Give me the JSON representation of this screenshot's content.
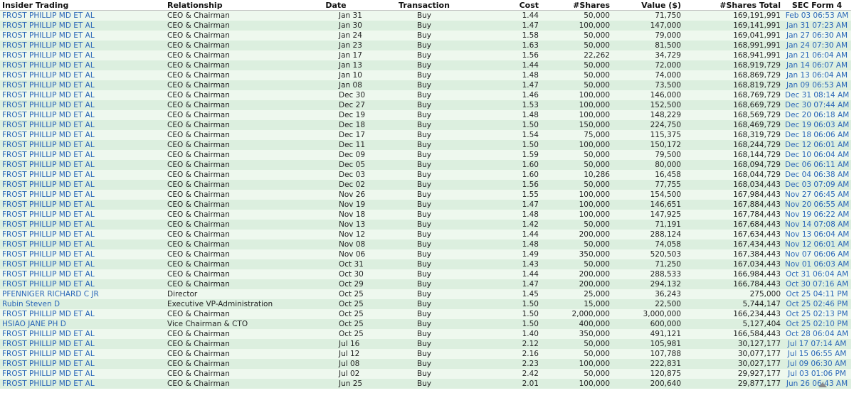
{
  "table": {
    "headers": [
      "Insider Trading",
      "Relationship",
      "Date",
      "Transaction",
      "Cost",
      "#Shares",
      "Value ($)",
      "#Shares Total",
      "SEC Form 4"
    ],
    "rows": [
      [
        "FROST PHILLIP MD ET AL",
        "CEO & Chairman",
        "Jan 31",
        "Buy",
        "1.44",
        "50,000",
        "71,750",
        "169,191,991",
        "Feb 03 06:53 AM"
      ],
      [
        "FROST PHILLIP MD ET AL",
        "CEO & Chairman",
        "Jan 30",
        "Buy",
        "1.47",
        "100,000",
        "147,000",
        "169,141,991",
        "Jan 31 07:23 AM"
      ],
      [
        "FROST PHILLIP MD ET AL",
        "CEO & Chairman",
        "Jan 24",
        "Buy",
        "1.58",
        "50,000",
        "79,000",
        "169,041,991",
        "Jan 27 06:30 AM"
      ],
      [
        "FROST PHILLIP MD ET AL",
        "CEO & Chairman",
        "Jan 23",
        "Buy",
        "1.63",
        "50,000",
        "81,500",
        "168,991,991",
        "Jan 24 07:30 AM"
      ],
      [
        "FROST PHILLIP MD ET AL",
        "CEO & Chairman",
        "Jan 17",
        "Buy",
        "1.56",
        "22,262",
        "34,729",
        "168,941,991",
        "Jan 21 06:04 AM"
      ],
      [
        "FROST PHILLIP MD ET AL",
        "CEO & Chairman",
        "Jan 13",
        "Buy",
        "1.44",
        "50,000",
        "72,000",
        "168,919,729",
        "Jan 14 06:07 AM"
      ],
      [
        "FROST PHILLIP MD ET AL",
        "CEO & Chairman",
        "Jan 10",
        "Buy",
        "1.48",
        "50,000",
        "74,000",
        "168,869,729",
        "Jan 13 06:04 AM"
      ],
      [
        "FROST PHILLIP MD ET AL",
        "CEO & Chairman",
        "Jan 08",
        "Buy",
        "1.47",
        "50,000",
        "73,500",
        "168,819,729",
        "Jan 09 06:53 AM"
      ],
      [
        "FROST PHILLIP MD ET AL",
        "CEO & Chairman",
        "Dec 30",
        "Buy",
        "1.46",
        "100,000",
        "146,000",
        "168,769,729",
        "Dec 31 08:14 AM"
      ],
      [
        "FROST PHILLIP MD ET AL",
        "CEO & Chairman",
        "Dec 27",
        "Buy",
        "1.53",
        "100,000",
        "152,500",
        "168,669,729",
        "Dec 30 07:44 AM"
      ],
      [
        "FROST PHILLIP MD ET AL",
        "CEO & Chairman",
        "Dec 19",
        "Buy",
        "1.48",
        "100,000",
        "148,229",
        "168,569,729",
        "Dec 20 06:18 AM"
      ],
      [
        "FROST PHILLIP MD ET AL",
        "CEO & Chairman",
        "Dec 18",
        "Buy",
        "1.50",
        "150,000",
        "224,750",
        "168,469,729",
        "Dec 19 06:03 AM"
      ],
      [
        "FROST PHILLIP MD ET AL",
        "CEO & Chairman",
        "Dec 17",
        "Buy",
        "1.54",
        "75,000",
        "115,375",
        "168,319,729",
        "Dec 18 06:06 AM"
      ],
      [
        "FROST PHILLIP MD ET AL",
        "CEO & Chairman",
        "Dec 11",
        "Buy",
        "1.50",
        "100,000",
        "150,172",
        "168,244,729",
        "Dec 12 06:01 AM"
      ],
      [
        "FROST PHILLIP MD ET AL",
        "CEO & Chairman",
        "Dec 09",
        "Buy",
        "1.59",
        "50,000",
        "79,500",
        "168,144,729",
        "Dec 10 06:04 AM"
      ],
      [
        "FROST PHILLIP MD ET AL",
        "CEO & Chairman",
        "Dec 05",
        "Buy",
        "1.60",
        "50,000",
        "80,000",
        "168,094,729",
        "Dec 06 06:11 AM"
      ],
      [
        "FROST PHILLIP MD ET AL",
        "CEO & Chairman",
        "Dec 03",
        "Buy",
        "1.60",
        "10,286",
        "16,458",
        "168,044,729",
        "Dec 04 06:38 AM"
      ],
      [
        "FROST PHILLIP MD ET AL",
        "CEO & Chairman",
        "Dec 02",
        "Buy",
        "1.56",
        "50,000",
        "77,755",
        "168,034,443",
        "Dec 03 07:09 AM"
      ],
      [
        "FROST PHILLIP MD ET AL",
        "CEO & Chairman",
        "Nov 26",
        "Buy",
        "1.55",
        "100,000",
        "154,500",
        "167,984,443",
        "Nov 27 06:45 AM"
      ],
      [
        "FROST PHILLIP MD ET AL",
        "CEO & Chairman",
        "Nov 19",
        "Buy",
        "1.47",
        "100,000",
        "146,651",
        "167,884,443",
        "Nov 20 06:55 AM"
      ],
      [
        "FROST PHILLIP MD ET AL",
        "CEO & Chairman",
        "Nov 18",
        "Buy",
        "1.48",
        "100,000",
        "147,925",
        "167,784,443",
        "Nov 19 06:22 AM"
      ],
      [
        "FROST PHILLIP MD ET AL",
        "CEO & Chairman",
        "Nov 13",
        "Buy",
        "1.42",
        "50,000",
        "71,191",
        "167,684,443",
        "Nov 14 07:08 AM"
      ],
      [
        "FROST PHILLIP MD ET AL",
        "CEO & Chairman",
        "Nov 12",
        "Buy",
        "1.44",
        "200,000",
        "288,124",
        "167,634,443",
        "Nov 13 06:04 AM"
      ],
      [
        "FROST PHILLIP MD ET AL",
        "CEO & Chairman",
        "Nov 08",
        "Buy",
        "1.48",
        "50,000",
        "74,058",
        "167,434,443",
        "Nov 12 06:01 AM"
      ],
      [
        "FROST PHILLIP MD ET AL",
        "CEO & Chairman",
        "Nov 06",
        "Buy",
        "1.49",
        "350,000",
        "520,503",
        "167,384,443",
        "Nov 07 06:06 AM"
      ],
      [
        "FROST PHILLIP MD ET AL",
        "CEO & Chairman",
        "Oct 31",
        "Buy",
        "1.43",
        "50,000",
        "71,250",
        "167,034,443",
        "Nov 01 06:03 AM"
      ],
      [
        "FROST PHILLIP MD ET AL",
        "CEO & Chairman",
        "Oct 30",
        "Buy",
        "1.44",
        "200,000",
        "288,533",
        "166,984,443",
        "Oct 31 06:04 AM"
      ],
      [
        "FROST PHILLIP MD ET AL",
        "CEO & Chairman",
        "Oct 29",
        "Buy",
        "1.47",
        "200,000",
        "294,132",
        "166,784,443",
        "Oct 30 07:16 AM"
      ],
      [
        "PFENNIGER RICHARD C JR",
        "Director",
        "Oct 25",
        "Buy",
        "1.45",
        "25,000",
        "36,243",
        "275,000",
        "Oct 25 04:11 PM"
      ],
      [
        "Rubin Steven D",
        "Executive VP-Administration",
        "Oct 25",
        "Buy",
        "1.50",
        "15,000",
        "22,500",
        "5,744,147",
        "Oct 25 02:46 PM"
      ],
      [
        "FROST PHILLIP MD ET AL",
        "CEO & Chairman",
        "Oct 25",
        "Buy",
        "1.50",
        "2,000,000",
        "3,000,000",
        "166,234,443",
        "Oct 25 02:13 PM"
      ],
      [
        "HSIAO JANE PH D",
        "Vice Chairman & CTO",
        "Oct 25",
        "Buy",
        "1.50",
        "400,000",
        "600,000",
        "5,127,404",
        "Oct 25 02:10 PM"
      ],
      [
        "FROST PHILLIP MD ET AL",
        "CEO & Chairman",
        "Oct 25",
        "Buy",
        "1.40",
        "350,000",
        "491,121",
        "166,584,443",
        "Oct 28 06:04 AM"
      ],
      [
        "FROST PHILLIP MD ET AL",
        "CEO & Chairman",
        "Jul 16",
        "Buy",
        "2.12",
        "50,000",
        "105,981",
        "30,127,177",
        "Jul 17 07:14 AM"
      ],
      [
        "FROST PHILLIP MD ET AL",
        "CEO & Chairman",
        "Jul 12",
        "Buy",
        "2.16",
        "50,000",
        "107,788",
        "30,077,177",
        "Jul 15 06:55 AM"
      ],
      [
        "FROST PHILLIP MD ET AL",
        "CEO & Chairman",
        "Jul 08",
        "Buy",
        "2.23",
        "100,000",
        "222,831",
        "30,027,177",
        "Jul 09 06:30 AM"
      ],
      [
        "FROST PHILLIP MD ET AL",
        "CEO & Chairman",
        "Jul 02",
        "Buy",
        "2.42",
        "50,000",
        "120,875",
        "29,927,177",
        "Jul 03 01:06 PM"
      ],
      [
        "FROST PHILLIP MD ET AL",
        "CEO & Chairman",
        "Jun 25",
        "Buy",
        "2.01",
        "100,000",
        "200,640",
        "29,877,177",
        "Jun 26 06:43 AM"
      ]
    ]
  },
  "colors": {
    "link": "#2a66b8",
    "row_light": "#eef8ee",
    "row_dark": "#dcefdf"
  },
  "icons": {
    "scroll_up": "scroll-up-arrow-icon"
  }
}
